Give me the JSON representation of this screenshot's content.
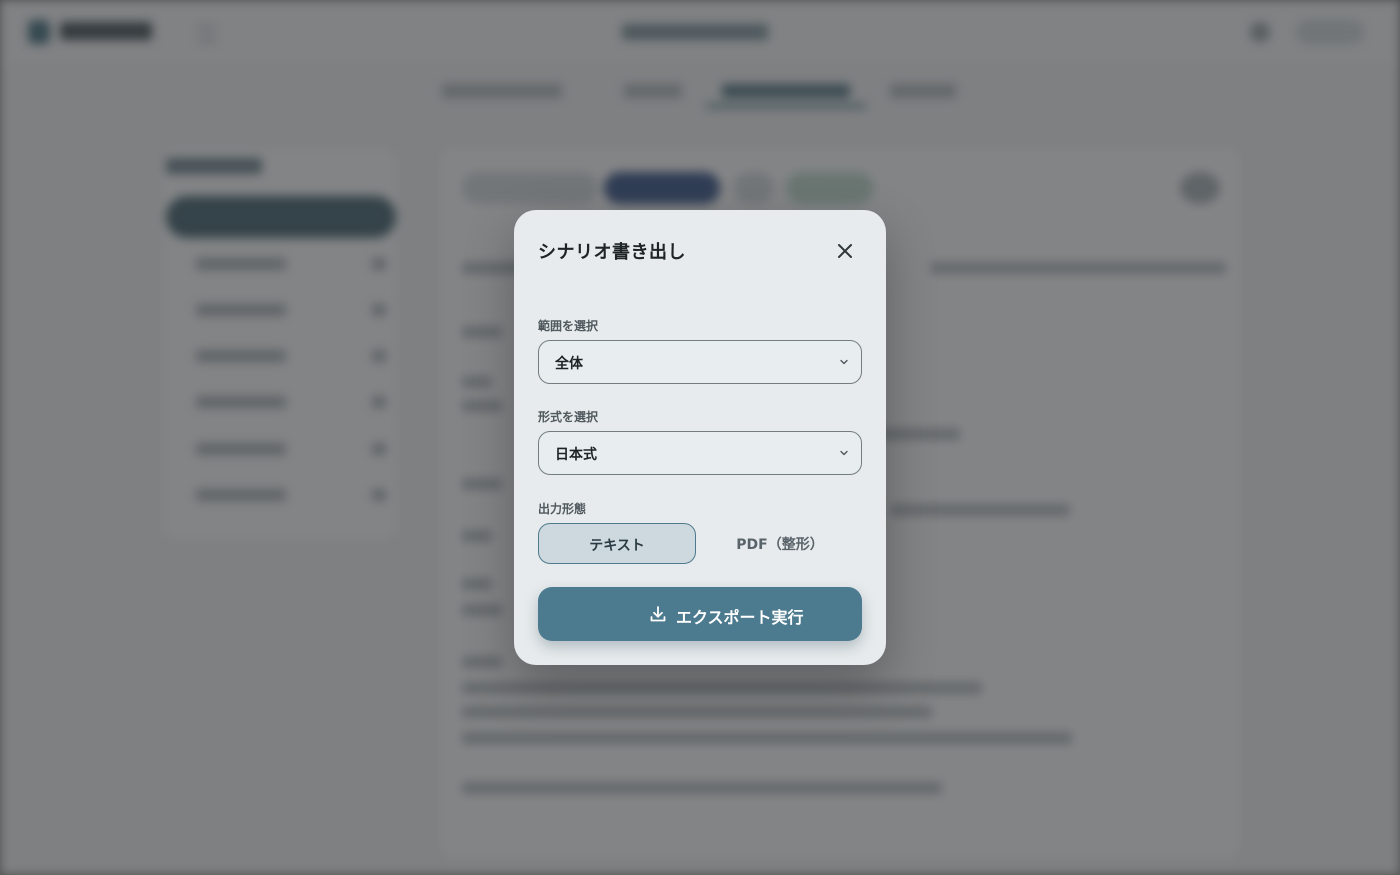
{
  "modal": {
    "title": "シナリオ書き出し",
    "close_icon": "close-icon",
    "range": {
      "label": "範囲を選択",
      "value": "全体"
    },
    "format": {
      "label": "形式を選択",
      "value": "日本式"
    },
    "output": {
      "label": "出力形態",
      "options": [
        {
          "label": "テキスト",
          "selected": true
        },
        {
          "label": "PDF（整形）",
          "selected": false
        }
      ]
    },
    "export_button": {
      "label": "エクスポート実行",
      "icon": "download-icon"
    }
  },
  "colors": {
    "accent": "#4c7a8e",
    "modal_background": "#e7ebed",
    "scrim": "#646768"
  }
}
